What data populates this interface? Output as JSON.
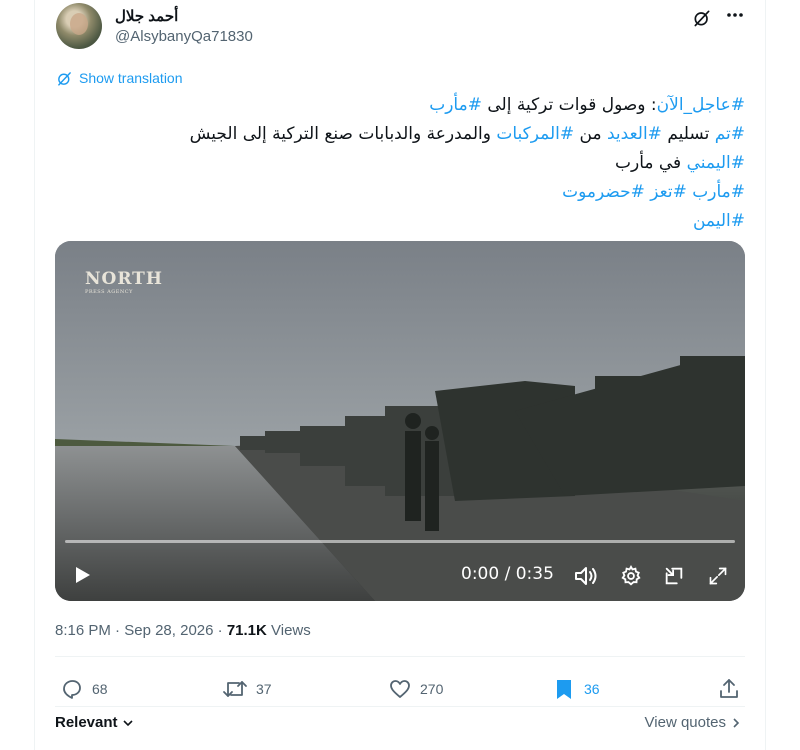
{
  "author": {
    "display_name": "أحمد جلال",
    "handle": "@AlsybanyQa71830"
  },
  "translate_label": "Show translation",
  "tweet": {
    "lines": [
      [
        {
          "t": "#عاجل_الآن",
          "tag": true
        },
        {
          "t": ": وصول قوات تركية إلى ",
          "tag": false
        },
        {
          "t": "#مأرب",
          "tag": true
        }
      ],
      [
        {
          "t": "#تم",
          "tag": true
        },
        {
          "t": " تسليم ",
          "tag": false
        },
        {
          "t": "#العديد",
          "tag": true
        },
        {
          "t": " من ",
          "tag": false
        },
        {
          "t": "#المركبات",
          "tag": true
        },
        {
          "t": " والمدرعة والدبابات صنع التركية إلى الجيش",
          "tag": false
        }
      ],
      [
        {
          "t": "#اليمني",
          "tag": true
        },
        {
          "t": " في مأرب",
          "tag": false
        }
      ],
      [
        {
          "t": "#مأرب",
          "tag": true
        },
        {
          "t": " ",
          "tag": false
        },
        {
          "t": "#تعز",
          "tag": true
        },
        {
          "t": " ",
          "tag": false
        },
        {
          "t": "#حضرموت",
          "tag": true
        }
      ],
      [
        {
          "t": "#اليمن",
          "tag": true
        }
      ]
    ]
  },
  "video": {
    "watermark": "NORTH",
    "watermark_sub": "PRESS AGENCY",
    "time": "0:00 / 0:35",
    "progress": 0.0
  },
  "meta": {
    "time": "8:16 PM",
    "separator": " · ",
    "date": "Sep 28, 2026",
    "views_count": "71.1K",
    "views_label": " Views"
  },
  "actions": {
    "replies": "68",
    "reposts": "37",
    "likes": "270",
    "bookmarks": "36"
  },
  "footer": {
    "relevant": "Relevant",
    "view_quotes": "View quotes"
  },
  "colors": {
    "accent": "#1d9bf0",
    "text": "#0f1419",
    "muted": "#536471"
  }
}
